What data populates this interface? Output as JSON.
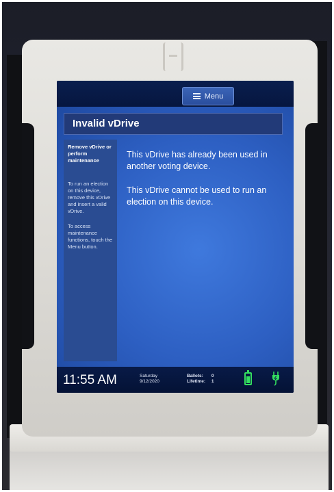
{
  "screen": {
    "menu_label": "Menu",
    "title": "Invalid vDrive",
    "sidebar": {
      "heading": "Remove vDrive or perform maintenance",
      "paragraphs": [
        "To run an election on this device, remove this vDrive and insert a valid vDrive.",
        "To access maintenance functions, touch the Menu button."
      ]
    },
    "message": [
      "This vDrive has already been used in another voting device.",
      "This vDrive cannot be used to run an election on this device."
    ],
    "status": {
      "time": "11:55 AM",
      "day": "Saturday",
      "date": "9/12/2020",
      "ballots_label": "Ballots:",
      "ballots_value": "0",
      "lifetime_label": "Lifetime:",
      "lifetime_value": "1"
    },
    "colors": {
      "screen_blue": "#2d5fc2",
      "status_green": "#34e05f"
    },
    "icons": [
      "menu-icon",
      "battery-icon",
      "power-plug-icon"
    ]
  }
}
